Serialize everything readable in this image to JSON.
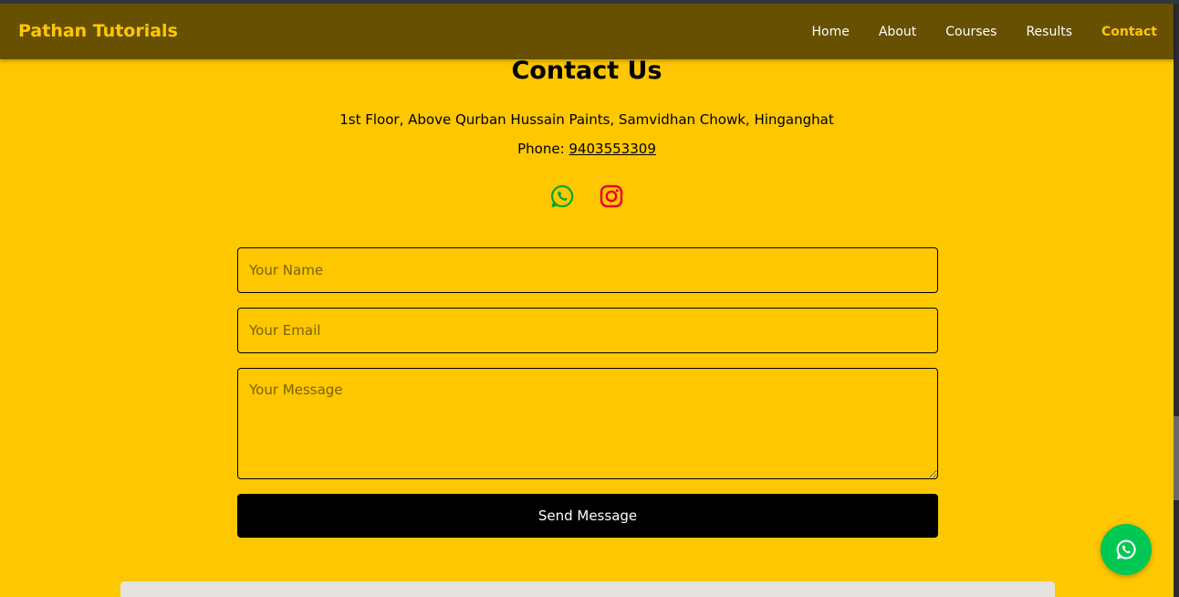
{
  "nav": {
    "brand": "Pathan Tutorials",
    "links": [
      {
        "label": "Home"
      },
      {
        "label": "About"
      },
      {
        "label": "Courses"
      },
      {
        "label": "Results"
      },
      {
        "label": "Contact",
        "active": true
      }
    ]
  },
  "contact": {
    "heading": "Contact Us",
    "address": "1st Floor, Above Qurban Hussain Paints, Samvidhan Chowk, Hinganghat",
    "phone_label": "Phone: ",
    "phone_number": "9403553309",
    "social_icons": [
      "whatsapp-icon",
      "instagram-icon"
    ]
  },
  "form": {
    "name_placeholder": "Your Name",
    "email_placeholder": "Your Email",
    "message_placeholder": "Your Message",
    "submit_label": "Send Message"
  },
  "floating": {
    "icon": "whatsapp-icon"
  },
  "colors": {
    "page_bg": "#fec700",
    "nav_bg": "#675000",
    "accent": "#fec700",
    "whatsapp": "#00a82d",
    "instagram": "#e4002b",
    "fab": "#00c853"
  }
}
